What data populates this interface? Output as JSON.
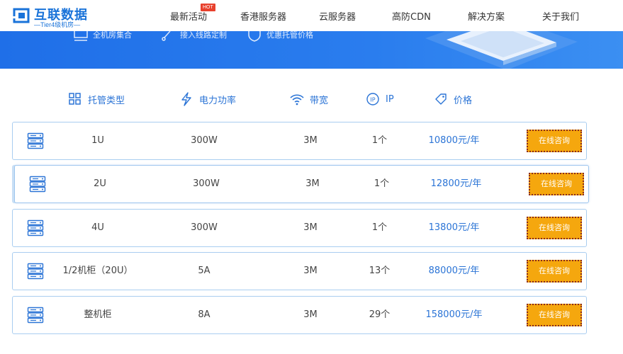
{
  "brand": {
    "title": "互联数据",
    "subtitle": "—Tier4级机房—"
  },
  "nav": {
    "items": [
      {
        "label": "最新活动"
      },
      {
        "label": "香港服务器"
      },
      {
        "label": "云服务器"
      },
      {
        "label": "高防CDN"
      },
      {
        "label": "解决方案"
      },
      {
        "label": "关于我们"
      }
    ],
    "hot_badge": "HOT"
  },
  "banner": {
    "items": [
      {
        "label": "全机房集合"
      },
      {
        "label": "接入线路定制"
      },
      {
        "label": "优惠托管价格"
      }
    ]
  },
  "table": {
    "headers": [
      {
        "label": "托管类型",
        "icon": "grid-icon"
      },
      {
        "label": "电力功率",
        "icon": "lightning-icon"
      },
      {
        "label": "带宽",
        "icon": "wifi-icon"
      },
      {
        "label": "IP",
        "icon": "ip-icon"
      },
      {
        "label": "价格",
        "icon": "price-tag-icon"
      }
    ],
    "rows": [
      {
        "type": "1U",
        "power": "300W",
        "bandwidth": "3M",
        "ip": "1个",
        "price": "10800元/年",
        "action": "在线咨询"
      },
      {
        "type": "2U",
        "power": "300W",
        "bandwidth": "3M",
        "ip": "1个",
        "price": "12800元/年",
        "action": "在线咨询"
      },
      {
        "type": "4U",
        "power": "300W",
        "bandwidth": "3M",
        "ip": "1个",
        "price": "13800元/年",
        "action": "在线咨询"
      },
      {
        "type": "1/2机柜（20U）",
        "power": "5A",
        "bandwidth": "3M",
        "ip": "13个",
        "price": "88000元/年",
        "action": "在线咨询"
      },
      {
        "type": "整机柜",
        "power": "8A",
        "bandwidth": "3M",
        "ip": "29个",
        "price": "158000元/年",
        "action": "在线咨询"
      }
    ]
  },
  "colors": {
    "accent": "#2b74d6",
    "banner": "#1f6fe8",
    "button": "#f5a70e",
    "row_border": "#a9cdf0",
    "hot": "#e8412d"
  }
}
